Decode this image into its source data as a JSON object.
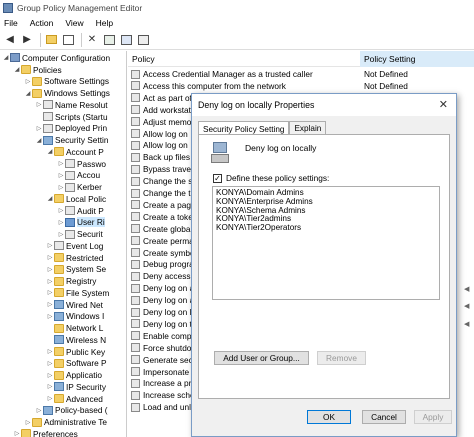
{
  "window": {
    "title": "Group Policy Management Editor"
  },
  "menu": [
    "File",
    "Action",
    "View",
    "Help"
  ],
  "toolbar_icons": [
    "back-icon",
    "forward-icon",
    "folder-up-icon",
    "show-hide-tree-icon",
    "delete-icon",
    "export-icon",
    "help-icon",
    "properties-icon"
  ],
  "tree": [
    {
      "label": "Computer Configuration",
      "indent": 0,
      "exp": "◢",
      "icon": "root"
    },
    {
      "label": "Policies",
      "indent": 1,
      "exp": "◢",
      "icon": "folder"
    },
    {
      "label": "Software Settings",
      "indent": 2,
      "exp": "▷",
      "icon": "folder"
    },
    {
      "label": "Windows Settings",
      "indent": 2,
      "exp": "◢",
      "icon": "folder"
    },
    {
      "label": "Name Resolut",
      "indent": 3,
      "exp": "▷",
      "icon": "gpo"
    },
    {
      "label": "Scripts (Startu",
      "indent": 3,
      "exp": "",
      "icon": "gpo"
    },
    {
      "label": "Deployed Prin",
      "indent": 3,
      "exp": "▷",
      "icon": "gpo"
    },
    {
      "label": "Security Settin",
      "indent": 3,
      "exp": "◢",
      "icon": "pol"
    },
    {
      "label": "Account P",
      "indent": 4,
      "exp": "◢",
      "icon": "folder"
    },
    {
      "label": "Passwo",
      "indent": 5,
      "exp": "▷",
      "icon": "gpo"
    },
    {
      "label": "Accou",
      "indent": 5,
      "exp": "▷",
      "icon": "gpo"
    },
    {
      "label": "Kerber",
      "indent": 5,
      "exp": "▷",
      "icon": "gpo"
    },
    {
      "label": "Local Polic",
      "indent": 4,
      "exp": "◢",
      "icon": "folder"
    },
    {
      "label": "Audit P",
      "indent": 5,
      "exp": "▷",
      "icon": "gpo"
    },
    {
      "label": "User Ri",
      "indent": 5,
      "exp": "▷",
      "icon": "sel",
      "selected": true
    },
    {
      "label": "Securit",
      "indent": 5,
      "exp": "▷",
      "icon": "gpo"
    },
    {
      "label": "Event Log",
      "indent": 4,
      "exp": "▷",
      "icon": "gpo"
    },
    {
      "label": "Restricted",
      "indent": 4,
      "exp": "▷",
      "icon": "folder"
    },
    {
      "label": "System Se",
      "indent": 4,
      "exp": "▷",
      "icon": "folder"
    },
    {
      "label": "Registry",
      "indent": 4,
      "exp": "▷",
      "icon": "folder"
    },
    {
      "label": "File System",
      "indent": 4,
      "exp": "▷",
      "icon": "folder"
    },
    {
      "label": "Wired Net",
      "indent": 4,
      "exp": "▷",
      "icon": "pol"
    },
    {
      "label": "Windows I",
      "indent": 4,
      "exp": "▷",
      "icon": "pol"
    },
    {
      "label": "Network L",
      "indent": 4,
      "exp": "",
      "icon": "folder"
    },
    {
      "label": "Wireless N",
      "indent": 4,
      "exp": "",
      "icon": "pol"
    },
    {
      "label": "Public Key",
      "indent": 4,
      "exp": "▷",
      "icon": "folder"
    },
    {
      "label": "Software P",
      "indent": 4,
      "exp": "▷",
      "icon": "folder"
    },
    {
      "label": "Applicatio",
      "indent": 4,
      "exp": "▷",
      "icon": "folder"
    },
    {
      "label": "IP Security",
      "indent": 4,
      "exp": "▷",
      "icon": "pol"
    },
    {
      "label": "Advanced",
      "indent": 4,
      "exp": "▷",
      "icon": "folder"
    },
    {
      "label": "Policy-based (",
      "indent": 3,
      "exp": "▷",
      "icon": "pol"
    },
    {
      "label": "Administrative Te",
      "indent": 2,
      "exp": "▷",
      "icon": "folder"
    },
    {
      "label": "Preferences",
      "indent": 1,
      "exp": "▷",
      "icon": "folder"
    }
  ],
  "list": {
    "col_policy": "Policy",
    "col_setting": "Policy Setting",
    "rows": [
      {
        "policy": "Access Credential Manager as a trusted caller",
        "setting": "Not Defined"
      },
      {
        "policy": "Access this computer from the network",
        "setting": "Not Defined"
      },
      {
        "policy": "Act as part of",
        "setting": ""
      },
      {
        "policy": "Add workstati",
        "setting": ""
      },
      {
        "policy": "Adjust memo",
        "setting": ""
      },
      {
        "policy": "Allow log on",
        "setting": ""
      },
      {
        "policy": "Allow log on",
        "setting": ""
      },
      {
        "policy": "Back up files a",
        "setting": ""
      },
      {
        "policy": "Bypass travers",
        "setting": ""
      },
      {
        "policy": "Change the sy",
        "setting": ""
      },
      {
        "policy": "Change the ti",
        "setting": ""
      },
      {
        "policy": "Create a page",
        "setting": ""
      },
      {
        "policy": "Create a toke",
        "setting": ""
      },
      {
        "policy": "Create global",
        "setting": ""
      },
      {
        "policy": "Create perma",
        "setting": ""
      },
      {
        "policy": "Create symbo",
        "setting": ""
      },
      {
        "policy": "Debug progra",
        "setting": ""
      },
      {
        "policy": "Deny access t",
        "setting": ""
      },
      {
        "policy": "Deny log on a",
        "setting": ""
      },
      {
        "policy": "Deny log on a",
        "setting": ""
      },
      {
        "policy": "Deny log on lo",
        "setting": ""
      },
      {
        "policy": "Deny log on t",
        "setting": ""
      },
      {
        "policy": "Enable compu",
        "setting": ""
      },
      {
        "policy": "Force shutdo",
        "setting": ""
      },
      {
        "policy": "Generate sec",
        "setting": ""
      },
      {
        "policy": "Impersonate a",
        "setting": ""
      },
      {
        "policy": "Increase a pro",
        "setting": ""
      },
      {
        "policy": "Increase sche",
        "setting": ""
      },
      {
        "policy": "Load and unlo",
        "setting": ""
      }
    ]
  },
  "dialog": {
    "title": "Deny log on locally Properties",
    "tabs": [
      "Security Policy Setting",
      "Explain"
    ],
    "policy_name": "Deny log on locally",
    "define_label": "Define these policy settings:",
    "define_checked": "✓",
    "users": [
      "KONYA\\Domain Admins",
      "KONYA\\Enterprise Admins",
      "KONYA\\Schema Admins",
      "KONYA\\Tier2admins",
      "KONYA\\Tier2Operators"
    ],
    "add_button": "Add User or Group...",
    "remove_button": "Remove",
    "ok": "OK",
    "cancel": "Cancel",
    "apply": "Apply"
  }
}
